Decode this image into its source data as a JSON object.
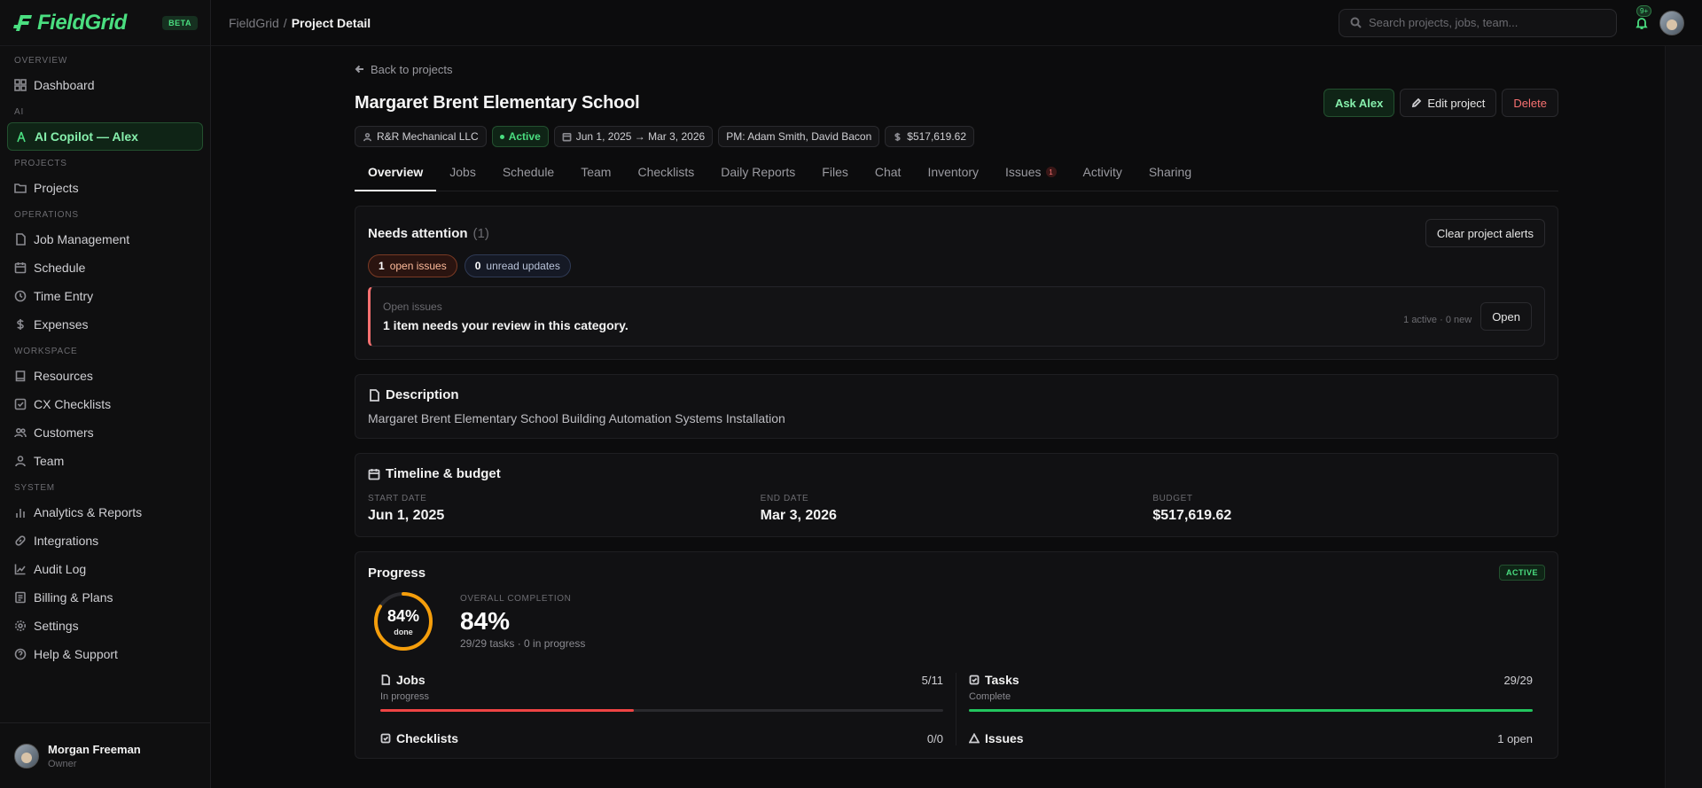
{
  "brand": {
    "name": "FieldGrid",
    "badge": "BETA"
  },
  "sidebar": {
    "sections": [
      {
        "title": "OVERVIEW",
        "items": [
          {
            "label": "Dashboard",
            "icon": "grid-icon"
          }
        ]
      },
      {
        "title": "AI",
        "items": [
          {
            "label": "AI Copilot — Alex",
            "icon": "person-icon"
          }
        ]
      },
      {
        "title": "PROJECTS",
        "items": [
          {
            "label": "Projects",
            "icon": "folder-icon"
          }
        ]
      },
      {
        "title": "OPERATIONS",
        "items": [
          {
            "label": "Job Management",
            "icon": "file-icon"
          },
          {
            "label": "Schedule",
            "icon": "calendar-icon"
          },
          {
            "label": "Time Entry",
            "icon": "clock-icon"
          },
          {
            "label": "Expenses",
            "icon": "dollar-icon"
          }
        ]
      },
      {
        "title": "WORKSPACE",
        "items": [
          {
            "label": "Resources",
            "icon": "book-icon"
          },
          {
            "label": "CX Checklists",
            "icon": "checkbox-icon"
          },
          {
            "label": "Customers",
            "icon": "users-icon"
          },
          {
            "label": "Team",
            "icon": "user-icon"
          }
        ]
      },
      {
        "title": "SYSTEM",
        "items": [
          {
            "label": "Analytics & Reports",
            "icon": "bar-chart-icon"
          },
          {
            "label": "Integrations",
            "icon": "link-icon"
          },
          {
            "label": "Audit Log",
            "icon": "line-chart-icon"
          },
          {
            "label": "Billing & Plans",
            "icon": "receipt-icon"
          },
          {
            "label": "Settings",
            "icon": "gear-icon"
          },
          {
            "label": "Help & Support",
            "icon": "help-icon"
          }
        ]
      }
    ],
    "user": {
      "name": "Morgan Freeman",
      "role": "Owner"
    }
  },
  "topbar": {
    "breadcrumb_root": "FieldGrid",
    "breadcrumb_sep": "/",
    "breadcrumb_current": "Project Detail",
    "search_placeholder": "Search projects, jobs, team...",
    "notification_badge": "9+"
  },
  "project": {
    "back_label": "Back to projects",
    "title": "Margaret Brent Elementary School",
    "actions": {
      "ask": "Ask Alex",
      "edit": "Edit project",
      "delete": "Delete"
    },
    "meta": {
      "client": "R&R Mechanical LLC",
      "status": "Active",
      "dates": "Jun 1, 2025 → Mar 3, 2026",
      "pm": "PM: Adam Smith, David Bacon",
      "budget": "$517,619.62"
    },
    "tabs": [
      "Overview",
      "Jobs",
      "Schedule",
      "Team",
      "Checklists",
      "Daily Reports",
      "Files",
      "Chat",
      "Inventory",
      "Issues",
      "Activity",
      "Sharing"
    ],
    "issues_tab_badge": "1"
  },
  "attention": {
    "title": "Needs attention",
    "count": "(1)",
    "clear_label": "Clear project alerts",
    "pill_issues_count": "1",
    "pill_issues_label": "open issues",
    "pill_updates_count": "0",
    "pill_updates_label": "unread updates",
    "item": {
      "category": "Open issues",
      "message": "1 item needs your review in this category.",
      "counts": "1 active · 0 new",
      "open_label": "Open"
    }
  },
  "description": {
    "title": "Description",
    "text": "Margaret Brent Elementary School Building Automation Systems Installation"
  },
  "timeline": {
    "title": "Timeline & budget",
    "start_label": "START DATE",
    "start_value": "Jun 1, 2025",
    "end_label": "END DATE",
    "end_value": "Mar 3, 2026",
    "budget_label": "BUDGET",
    "budget_value": "$517,619.62"
  },
  "progress": {
    "title": "Progress",
    "badge": "ACTIVE",
    "ring_pct": "84%",
    "ring_done": "done",
    "ring_fraction": 0.84,
    "overall_label": "OVERALL COMPLETION",
    "overall_value": "84%",
    "overall_sub": "29/29 tasks · 0 in progress",
    "stats": [
      {
        "title": "Jobs",
        "count": "5/11",
        "sub": "In progress",
        "fraction": 0.45,
        "color": "#ef4444",
        "icon": "file-icon"
      },
      {
        "title": "Tasks",
        "count": "29/29",
        "sub": "Complete",
        "fraction": 1.0,
        "color": "#22c55e",
        "icon": "checkbox-icon"
      },
      {
        "title": "Checklists",
        "count": "0/0",
        "icon": "checkbox-icon"
      },
      {
        "title": "Issues",
        "count": "1 open",
        "icon": "warning-icon"
      }
    ]
  },
  "colors": {
    "accent": "#4ade80",
    "danger": "#f87171",
    "ring": "#f59e0b"
  }
}
